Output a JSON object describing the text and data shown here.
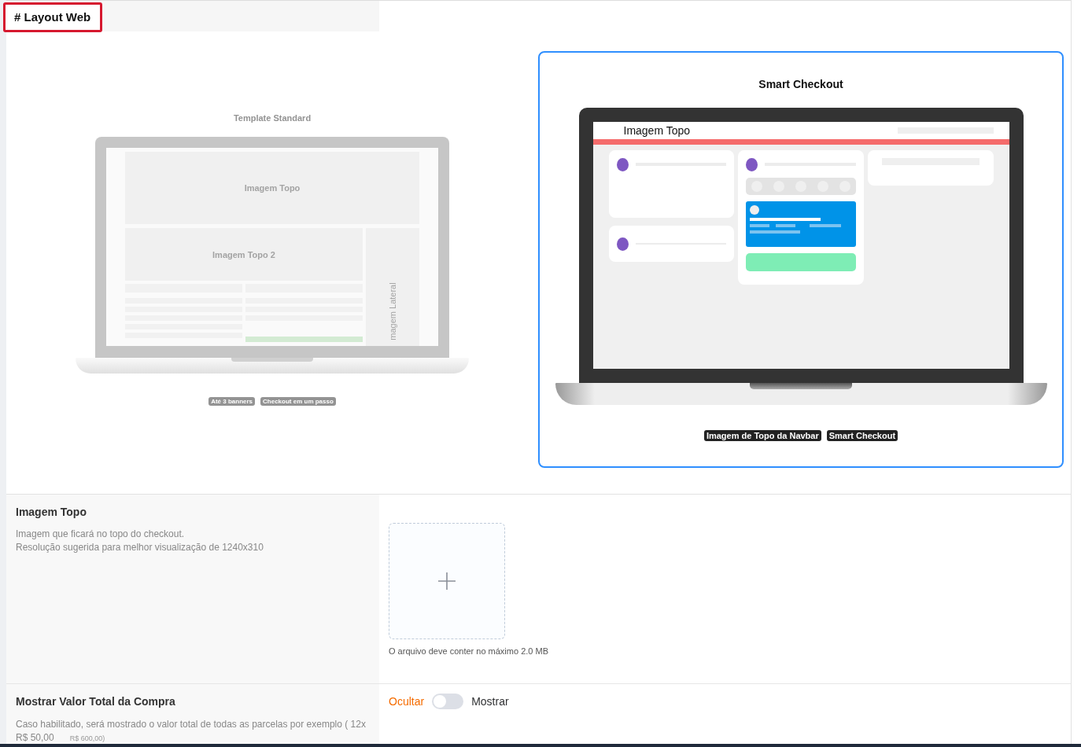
{
  "section_tab": {
    "label": "# Layout Web"
  },
  "templates": [
    {
      "kind": "standard",
      "title": "Template Standard",
      "selected": false,
      "screen_labels": [
        "Imagem Topo",
        "Imagem Topo 2",
        "magem Lateral"
      ],
      "tags": [
        "Até 3 banners",
        "Checkout em um passo"
      ]
    },
    {
      "kind": "smart",
      "title": "Smart Checkout",
      "selected": true,
      "screen_labels": [
        "Imagem Topo"
      ],
      "tags": [
        "Imagem de Topo da Navbar",
        "Smart Checkout"
      ]
    }
  ],
  "settings": [
    {
      "kind": "upload",
      "title": "Imagem Topo",
      "description": [
        "Imagem que ficará no topo do checkout.",
        "Resolução sugerida para melhor visualização de 1240x310"
      ],
      "hint": "O arquivo deve conter no máximo 2.0 MB"
    },
    {
      "kind": "toggle",
      "title": "Mostrar Valor Total da Compra",
      "description": [
        "Caso habilitado, será mostrado o valor total de todas as parcelas por exemplo ( 12x",
        "R$ 50,00"
      ],
      "small_note": "R$ 600,00)",
      "off_label": "Ocultar",
      "on_label": "Mostrar",
      "on": false
    }
  ]
}
